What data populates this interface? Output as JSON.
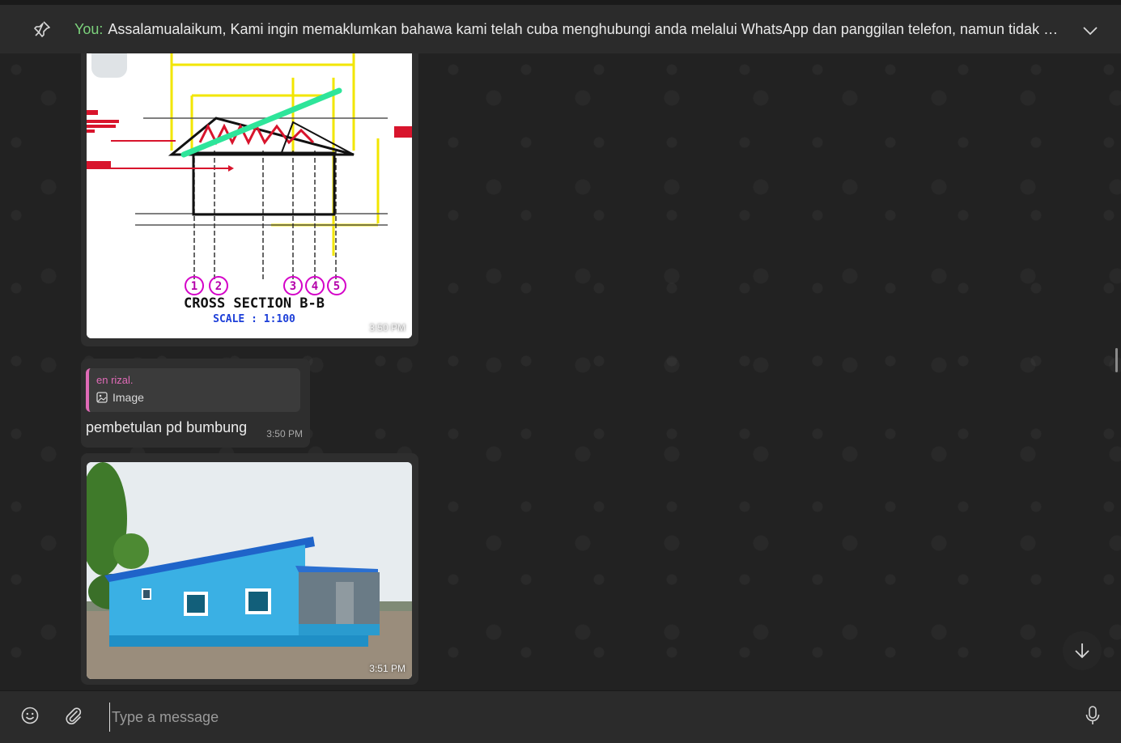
{
  "pinned": {
    "author": "You:",
    "text": "Assalamualaikum,  Kami ingin memaklumkan bahawa kami telah cuba menghubungi anda melalui WhatsApp dan panggilan telefon, namun tidak mener..."
  },
  "messages": [
    {
      "type": "image",
      "time": "3:50 PM"
    },
    {
      "type": "reply",
      "quote_author": "en rizal.",
      "quote_label": "Image",
      "text": "pembetulan pd bumbung",
      "time": "3:50 PM"
    },
    {
      "type": "image",
      "time": "3:51 PM"
    }
  ],
  "drawing": {
    "title": "CROSS SECTION B-B",
    "scale": "SCALE : 1:100",
    "gridlines": [
      "1",
      "2",
      "3",
      "4",
      "5"
    ]
  },
  "composer": {
    "placeholder": "Type a message"
  },
  "colors": {
    "accent_green": "#7cd27c",
    "quote_pink": "#e06bb7",
    "bubble": "#2e2e2e"
  },
  "icons": [
    "pin-icon",
    "chevron-down-icon",
    "emoji-icon",
    "paperclip-icon",
    "microphone-icon",
    "arrow-down-icon",
    "image-icon"
  ]
}
